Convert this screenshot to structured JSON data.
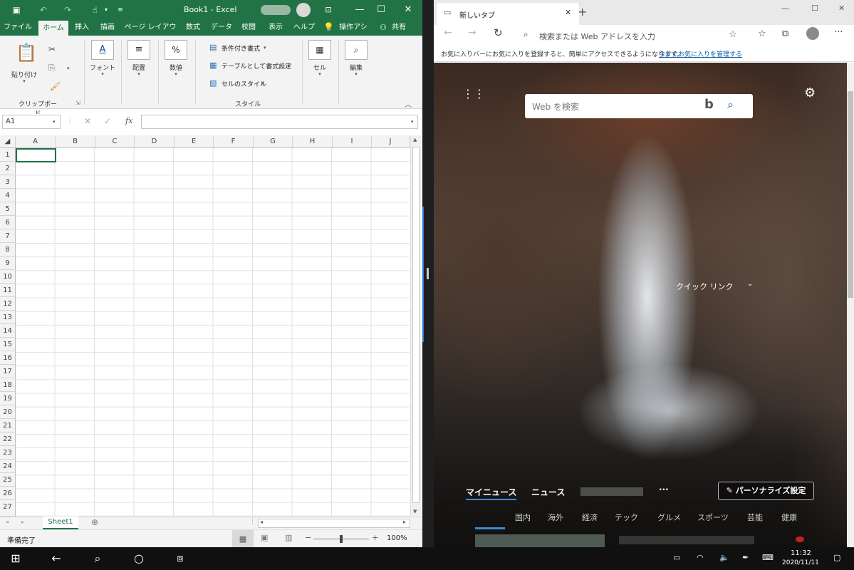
{
  "excel": {
    "title": "Book1  -  Excel",
    "tabs": [
      "ファイル",
      "ホーム",
      "挿入",
      "描画",
      "ページ レイアウト",
      "数式",
      "データ",
      "校閲",
      "表示",
      "ヘルプ",
      "操作アシ",
      "共有"
    ],
    "ribbon": {
      "paste_label": "貼り付け",
      "clipboard_group": "クリップボード",
      "font_label": "フォント",
      "align_label": "配置",
      "number_label": "数値",
      "cond_format": "条件付き書式",
      "table_format": "テーブルとして書式設定",
      "cell_style": "セルのスタイル",
      "styles_group": "スタイル",
      "cells_label": "セル",
      "edit_label": "編集"
    },
    "name_box": "A1",
    "fx": "fx",
    "columns": [
      "A",
      "B",
      "C",
      "D",
      "E",
      "F",
      "G",
      "H",
      "I",
      "J"
    ],
    "rows": [
      "1",
      "2",
      "3",
      "4",
      "5",
      "6",
      "7",
      "8",
      "9",
      "10",
      "11",
      "12",
      "13",
      "14",
      "15",
      "16",
      "17",
      "18",
      "19",
      "20",
      "21",
      "22",
      "23",
      "24",
      "25",
      "26",
      "27"
    ],
    "sheet_tab": "Sheet1",
    "status": "準備完了",
    "zoom": "100%"
  },
  "edge": {
    "tab_title": "新しいタブ",
    "address_placeholder": "検索または Web アドレスを入力",
    "favbar_text": "お気に入りバーにお気に入りを登録すると、簡単にアクセスできるようになります。",
    "favbar_link": "今すぐお気に入りを管理する",
    "search_placeholder": "Web を検索",
    "quick_links": "クイック リンク",
    "news_tabs": [
      "マイニュース",
      "ニュース"
    ],
    "more": "···",
    "personalize": "パーソナライズ設定",
    "categories": [
      "国内",
      "海外",
      "経済",
      "テック",
      "グルメ",
      "スポーツ",
      "芸能",
      "健康"
    ]
  },
  "taskbar": {
    "time": "11:32",
    "date": "2020/11/11"
  }
}
